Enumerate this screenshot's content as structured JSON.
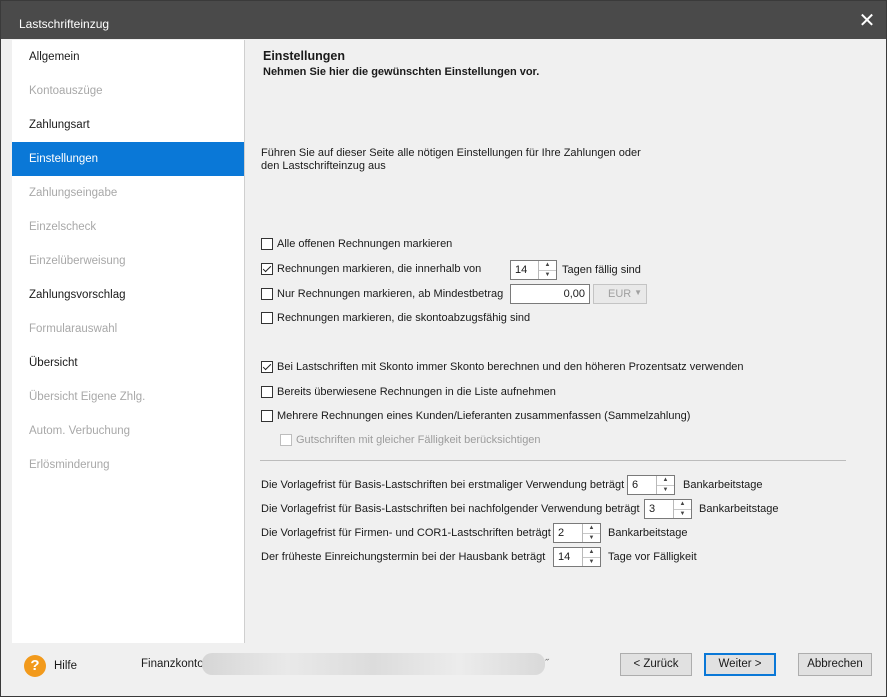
{
  "window": {
    "title": "Lastschrifteinzug",
    "close": "✕"
  },
  "sidebar": {
    "items": [
      {
        "label": "Allgemein",
        "state": "enabled"
      },
      {
        "label": "Kontoauszüge",
        "state": "disabled"
      },
      {
        "label": "Zahlungsart",
        "state": "enabled"
      },
      {
        "label": "Einstellungen",
        "state": "selected"
      },
      {
        "label": "Zahlungseingabe",
        "state": "disabled"
      },
      {
        "label": "Einzelscheck",
        "state": "disabled"
      },
      {
        "label": "Einzelüberweisung",
        "state": "disabled"
      },
      {
        "label": "Zahlungsvorschlag",
        "state": "enabled"
      },
      {
        "label": "Formularauswahl",
        "state": "disabled"
      },
      {
        "label": "Übersicht",
        "state": "enabled"
      },
      {
        "label": "Übersicht Eigene Zhlg.",
        "state": "disabled"
      },
      {
        "label": "Autom. Verbuchung",
        "state": "disabled"
      },
      {
        "label": "Erlösminderung",
        "state": "disabled"
      }
    ]
  },
  "main": {
    "heading": "Einstellungen",
    "subheading": "Nehmen Sie hier die gewünschten Einstellungen vor.",
    "intro_line1": "Führen Sie auf dieser Seite alle nötigen Einstellungen für Ihre Zahlungen oder",
    "intro_line2": "den Lastschrifteinzug aus",
    "options": {
      "all_open": {
        "label": "Alle offenen Rechnungen markieren",
        "checked": false
      },
      "within_days": {
        "label": "Rechnungen markieren, die innerhalb von",
        "checked": true,
        "value": "14",
        "suffix": "Tagen fällig sind"
      },
      "min_amount": {
        "label": "Nur Rechnungen markieren, ab Mindestbetrag",
        "checked": false,
        "value": "0,00",
        "currency": "EUR"
      },
      "skonto_eligible": {
        "label": "Rechnungen markieren, die skontoabzugsfähig sind",
        "checked": false
      },
      "always_skonto": {
        "label": "Bei Lastschriften mit Skonto immer Skonto berechnen und den höheren Prozentsatz verwenden",
        "checked": true
      },
      "already_transferred": {
        "label": "Bereits überwiesene Rechnungen in die Liste aufnehmen",
        "checked": false
      },
      "combine": {
        "label": "Mehrere Rechnungen eines Kunden/Lieferanten zusammenfassen (Sammelzahlung)",
        "checked": false
      },
      "credits_same_due": {
        "label": "Gutschriften mit gleicher Fälligkeit berücksichtigen",
        "checked": false,
        "disabled": true
      }
    },
    "lead_times": {
      "basis_first": {
        "label": "Die Vorlagefrist für Basis-Lastschriften bei erstmaliger Verwendung beträgt",
        "value": "6",
        "unit": "Bankarbeitstage"
      },
      "basis_next": {
        "label": "Die Vorlagefrist für Basis-Lastschriften bei nachfolgender Verwendung beträgt",
        "value": "3",
        "unit": "Bankarbeitstage"
      },
      "firmen_cor1": {
        "label": "Die Vorlagefrist für Firmen- und COR1-Lastschriften beträgt",
        "value": "2",
        "unit": "Bankarbeitstage"
      },
      "earliest": {
        "label": "Der früheste Einreichungstermin bei der Hausbank beträgt",
        "value": "14",
        "unit": "Tage vor Fälligkeit"
      }
    }
  },
  "footer": {
    "help_icon": "?",
    "help": "Hilfe",
    "finanzkonto_label": "Finanzkonto.",
    "finanzkonto_mark": "˝",
    "back": "< Zurück",
    "next": "Weiter >",
    "cancel": "Abbrechen"
  },
  "spin_up": "▲",
  "spin_down": "▼",
  "combo_arrow": "▼"
}
